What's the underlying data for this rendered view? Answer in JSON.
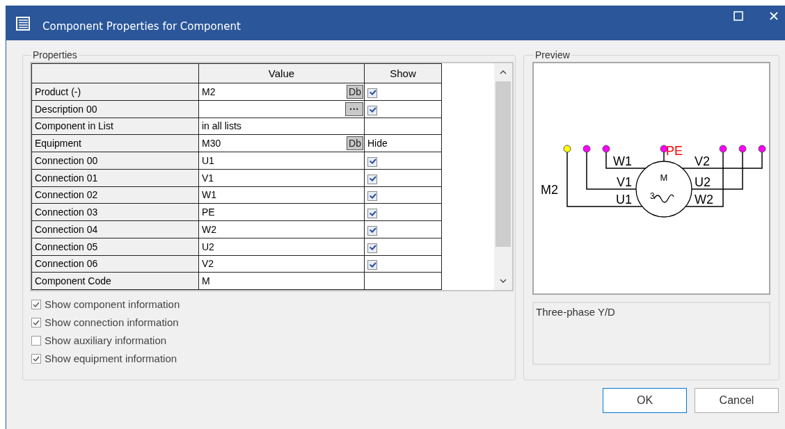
{
  "window": {
    "title": "Component Properties for Component"
  },
  "properties": {
    "title": "Properties",
    "columns": [
      "Value",
      "Show"
    ],
    "rows": [
      {
        "name": "Product (-)",
        "value": "M2",
        "button": "Db",
        "show": {
          "kind": "checkbox",
          "checked": true
        }
      },
      {
        "name": "Description 00",
        "value": "",
        "button": "···",
        "show": {
          "kind": "checkbox",
          "checked": true
        }
      },
      {
        "name": "Component in List",
        "value": "in all lists"
      },
      {
        "name": "Equipment",
        "value": "M30",
        "button": "Db",
        "show": {
          "kind": "text",
          "text": "Hide"
        }
      },
      {
        "name": "Connection 00",
        "value": "U1",
        "show": {
          "kind": "checkbox",
          "checked": true
        }
      },
      {
        "name": "Connection 01",
        "value": "V1",
        "show": {
          "kind": "checkbox",
          "checked": true
        }
      },
      {
        "name": "Connection 02",
        "value": "W1",
        "show": {
          "kind": "checkbox",
          "checked": true
        }
      },
      {
        "name": "Connection 03",
        "value": "PE",
        "show": {
          "kind": "checkbox",
          "checked": true
        }
      },
      {
        "name": "Connection 04",
        "value": "W2",
        "show": {
          "kind": "checkbox",
          "checked": true
        }
      },
      {
        "name": "Connection 05",
        "value": "U2",
        "show": {
          "kind": "checkbox",
          "checked": true
        }
      },
      {
        "name": "Connection 06",
        "value": "V2",
        "show": {
          "kind": "checkbox",
          "checked": true
        }
      },
      {
        "name": "Component Code",
        "value": "M"
      }
    ],
    "options": [
      {
        "label": "Show component information",
        "checked": true
      },
      {
        "label": "Show connection information",
        "checked": true
      },
      {
        "label": "Show auxiliary information",
        "checked": false
      },
      {
        "label": "Show equipment information",
        "checked": true
      }
    ]
  },
  "preview": {
    "title": "Preview",
    "diagram": {
      "device_label": "M2",
      "pe_label": "PE",
      "motor_label": "M",
      "phase_label": "3",
      "left_labels": [
        "W1",
        "V1",
        "U1"
      ],
      "right_labels": [
        "V2",
        "U2",
        "W2"
      ],
      "pins": [
        {
          "color": "#ffff00"
        },
        {
          "color": "#ff00ff"
        },
        {
          "color": "#ff00ff"
        },
        {
          "color": "#ff00ff"
        },
        {
          "color": "#ff00ff"
        },
        {
          "color": "#ff00ff"
        },
        {
          "color": "#ff00ff"
        }
      ]
    },
    "description": "Three-phase Y/D"
  },
  "buttons": [
    {
      "label": "OK",
      "default": true
    },
    {
      "label": "Cancel",
      "default": false
    }
  ]
}
